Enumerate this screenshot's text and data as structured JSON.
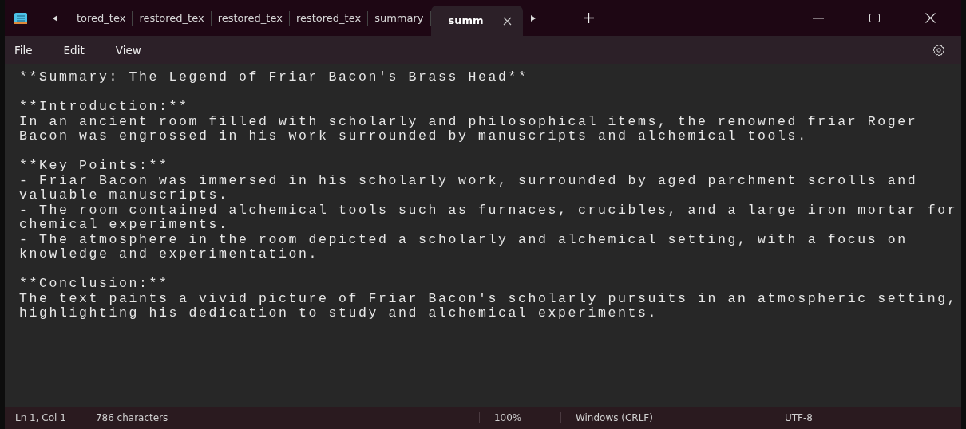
{
  "tabs": [
    {
      "label": "tored_tex",
      "selected": false
    },
    {
      "label": "restored_tex",
      "selected": false
    },
    {
      "label": "restored_tex",
      "selected": false
    },
    {
      "label": "restored_tex",
      "selected": false
    },
    {
      "label": "summary",
      "selected": false
    },
    {
      "label": "summ",
      "selected": true
    }
  ],
  "menu": [
    "File",
    "Edit",
    "View"
  ],
  "document": {
    "blocks": [
      [
        "**Summary: The Legend of Friar Bacon's Brass Head**"
      ],
      [
        "**Introduction:**",
        "In an ancient room filled with scholarly and philosophical items, the renowned friar Roger",
        "Bacon was engrossed in his work surrounded by manuscripts and alchemical tools."
      ],
      [
        "**Key Points:**",
        "- Friar Bacon was immersed in his scholarly work, surrounded by aged parchment scrolls and",
        "valuable manuscripts.",
        "- The room contained alchemical tools such as furnaces, crucibles, and a large iron mortar for",
        "chemical experiments.",
        "- The atmosphere in the room depicted a scholarly and alchemical setting, with a focus on",
        "knowledge and experimentation."
      ],
      [
        "**Conclusion:**",
        "The text paints a vivid picture of Friar Bacon's scholarly pursuits in an atmospheric setting,",
        "highlighting his dedication to study and alchemical experiments."
      ]
    ]
  },
  "status_bar": {
    "position": "Ln 1, Col 1",
    "characters": "786 characters",
    "zoom": "100%",
    "line_ending": "Windows (CRLF)",
    "encoding": "UTF-8"
  }
}
